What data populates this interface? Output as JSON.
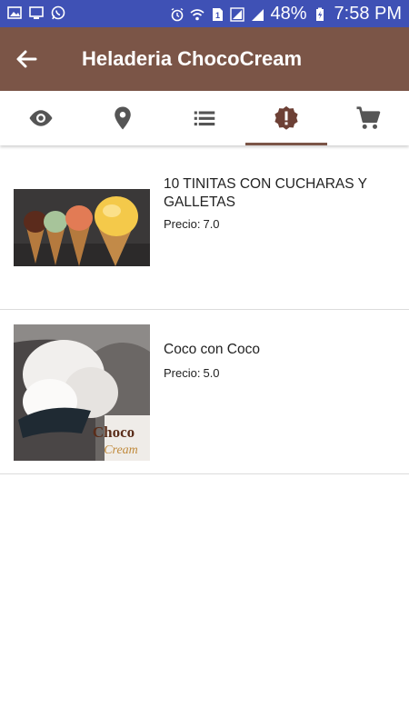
{
  "status_bar": {
    "battery": "48%",
    "time": "7:58 PM",
    "color": "#3f51b5"
  },
  "app_bar": {
    "title": "Heladeria ChocoCream",
    "color": "#7b5547"
  },
  "tabs": [
    {
      "icon": "eye-icon",
      "active": false
    },
    {
      "icon": "location-pin-icon",
      "active": false
    },
    {
      "icon": "list-icon",
      "active": false
    },
    {
      "icon": "alert-badge-icon",
      "active": true
    },
    {
      "icon": "cart-icon",
      "active": false
    }
  ],
  "products": [
    {
      "name": "10 TINITAS CON CUCHARAS Y GALLETAS",
      "price_label": "Precio:",
      "price": "7.0",
      "image": "ice-cream-cones"
    },
    {
      "name": "Coco con Coco",
      "price_label": "Precio:",
      "price": "5.0",
      "image": "coconut-ice-cream",
      "logo_text": "Choco",
      "logo_subtext": "Cream"
    }
  ]
}
